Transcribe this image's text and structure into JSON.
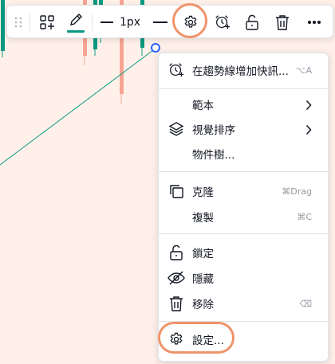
{
  "toolbar": {
    "line_width_label": "1px",
    "icons": [
      "drag-handle-icon",
      "add-object-icon",
      "pencil-icon",
      "line-width",
      "line-style",
      "gear-icon",
      "alarm-add-icon",
      "unlock-icon",
      "trash-icon",
      "more-icon"
    ],
    "pencil_underline_color": "#089981",
    "highlight_color": "#f0936a"
  },
  "chart": {
    "background": "#fff1ea",
    "up_color": "#089981",
    "down_color": "#f7a593",
    "trend_line_color": "#089981"
  },
  "menu": {
    "items": [
      {
        "label": "在趨勢線增加快訊...",
        "hint": "⌥A",
        "icon": "alarm-add-icon"
      },
      {
        "label": "範本",
        "icon": "",
        "has_submenu": true
      },
      {
        "label": "視覺排序",
        "icon": "layers-icon",
        "has_submenu": true
      },
      {
        "label": "物件樹...",
        "icon": ""
      },
      {
        "label": "克隆",
        "hint": "⌘Drag",
        "icon": "clone-icon"
      },
      {
        "label": "複製",
        "hint": "⌘C",
        "icon": ""
      },
      {
        "label": "鎖定",
        "icon": "unlock-icon"
      },
      {
        "label": "隱藏",
        "icon": "eye-off-icon"
      },
      {
        "label": "移除",
        "hint": "⌫",
        "icon": "trash-icon"
      },
      {
        "label": "設定...",
        "icon": "gear-icon"
      }
    ]
  }
}
